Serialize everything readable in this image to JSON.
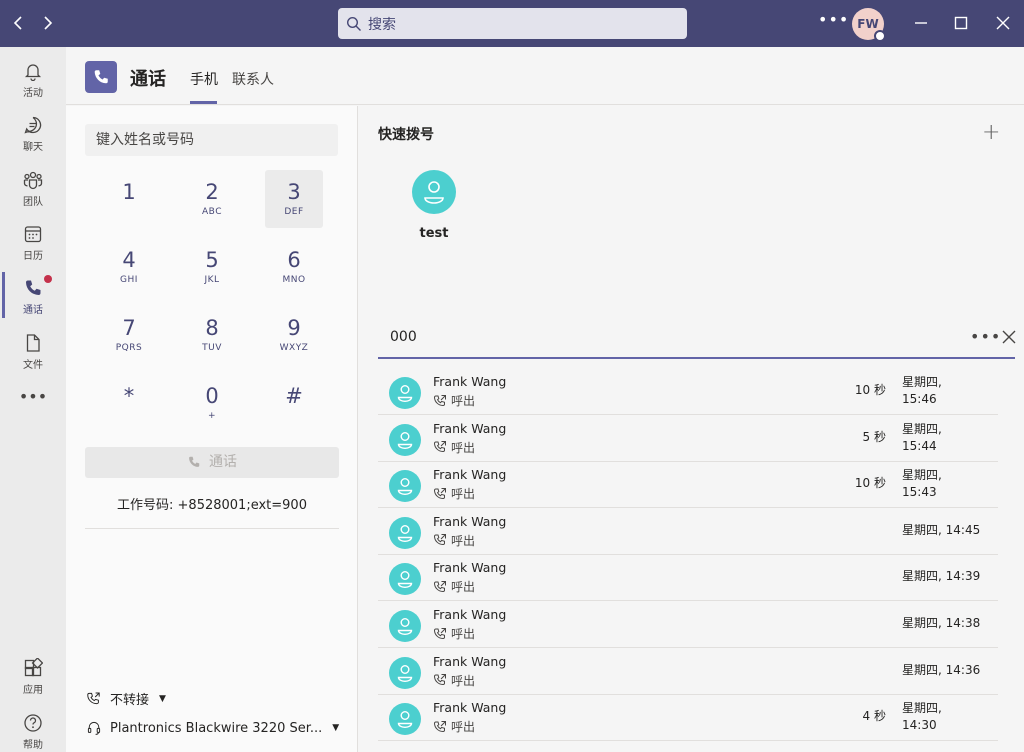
{
  "titlebar": {
    "search_placeholder": "搜索",
    "avatar_initials": "FW"
  },
  "rail": {
    "items": [
      {
        "label": "活动"
      },
      {
        "label": "聊天"
      },
      {
        "label": "团队"
      },
      {
        "label": "日历"
      },
      {
        "label": "通话"
      },
      {
        "label": "文件"
      },
      {
        "label": "应用"
      },
      {
        "label": "帮助"
      }
    ]
  },
  "header": {
    "title": "通话",
    "tabs": [
      {
        "label": "手机"
      },
      {
        "label": "联系人"
      }
    ]
  },
  "dialpad": {
    "placeholder": "键入姓名或号码",
    "keys": [
      {
        "num": "1",
        "sub": ""
      },
      {
        "num": "2",
        "sub": "ABC"
      },
      {
        "num": "3",
        "sub": "DEF"
      },
      {
        "num": "4",
        "sub": "GHI"
      },
      {
        "num": "5",
        "sub": "JKL"
      },
      {
        "num": "6",
        "sub": "MNO"
      },
      {
        "num": "7",
        "sub": "PQRS"
      },
      {
        "num": "8",
        "sub": "TUV"
      },
      {
        "num": "9",
        "sub": "WXYZ"
      },
      {
        "num": "*",
        "sub": ""
      },
      {
        "num": "0",
        "sub": "+"
      },
      {
        "num": "#",
        "sub": ""
      }
    ],
    "call_label": "通话",
    "work_number": "工作号码: +8528001;ext=900",
    "forwarding": "不转接",
    "device": "Plantronics Blackwire 3220 Ser..."
  },
  "speed_dial": {
    "title": "快速拨号",
    "contacts": [
      {
        "name": "test"
      }
    ]
  },
  "history": {
    "filter_value": "000",
    "rows": [
      {
        "name": "Frank Wang",
        "type": "呼出",
        "duration": "10 秒",
        "time_line1": "星期四,",
        "time_line2": "15:46"
      },
      {
        "name": "Frank Wang",
        "type": "呼出",
        "duration": "5 秒",
        "time_line1": "星期四,",
        "time_line2": "15:44"
      },
      {
        "name": "Frank Wang",
        "type": "呼出",
        "duration": "10 秒",
        "time_line1": "星期四,",
        "time_line2": "15:43"
      },
      {
        "name": "Frank Wang",
        "type": "呼出",
        "duration": "",
        "time_line1": "星期四, 14:45",
        "time_line2": ""
      },
      {
        "name": "Frank Wang",
        "type": "呼出",
        "duration": "",
        "time_line1": "星期四, 14:39",
        "time_line2": ""
      },
      {
        "name": "Frank Wang",
        "type": "呼出",
        "duration": "",
        "time_line1": "星期四, 14:38",
        "time_line2": ""
      },
      {
        "name": "Frank Wang",
        "type": "呼出",
        "duration": "",
        "time_line1": "星期四, 14:36",
        "time_line2": ""
      },
      {
        "name": "Frank Wang",
        "type": "呼出",
        "duration": "4 秒",
        "time_line1": "星期四,",
        "time_line2": "14:30"
      }
    ]
  },
  "colors": {
    "brand": "#464775",
    "accent": "#6264a7",
    "avatar_teal": "#4ccfcf",
    "badge_red": "#c4314b"
  }
}
